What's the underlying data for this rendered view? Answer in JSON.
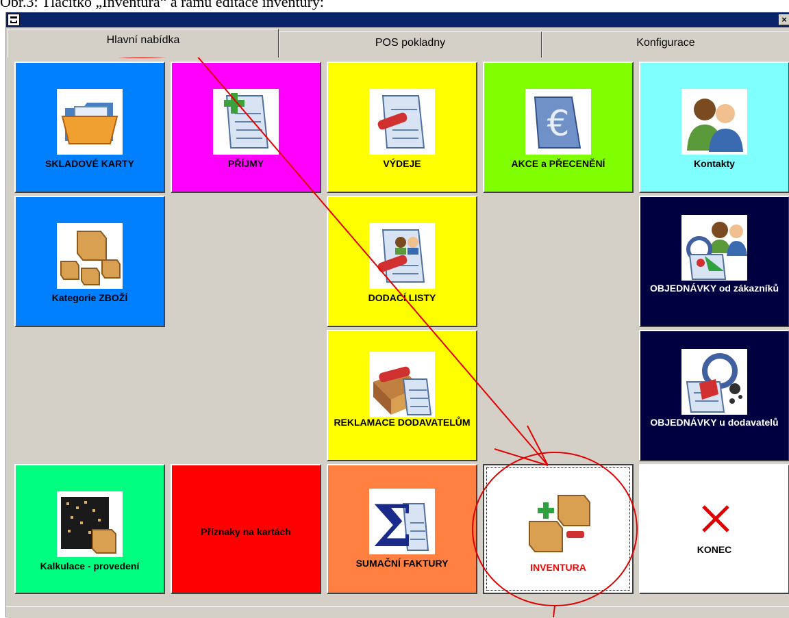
{
  "caption": "Obr.3: Tlačítko „Inventura“ a rámu editace inventury:",
  "window": {
    "close_label": "×"
  },
  "tabs": [
    {
      "label": "Hlavní nabídka",
      "active": true
    },
    {
      "label": "POS pokladny",
      "active": false
    },
    {
      "label": "Konfigurace",
      "active": false
    }
  ],
  "tiles": {
    "skladove_karty": {
      "label": "SKLADOVÉ KARTY",
      "color": "#0080ff",
      "icon": "folder-icon"
    },
    "prijmy": {
      "label": "PŘÍJMY",
      "color": "#ff00ff",
      "icon": "document-add-icon"
    },
    "vydeje": {
      "label": "VÝDEJE",
      "color": "#ffff00",
      "icon": "document-remove-icon"
    },
    "akce": {
      "label": "AKCE a PŘECENĚNÍ",
      "color": "#80ff00",
      "icon": "euro-document-icon"
    },
    "kontakty": {
      "label": "Kontakty",
      "color": "#80ffff",
      "icon": "people-icon"
    },
    "kategorie": {
      "label": "Kategorie ZBOŽÍ",
      "color": "#0080ff",
      "icon": "boxes-icon"
    },
    "dodaci_listy": {
      "label": "DODACÍ LISTY",
      "color": "#ffff00",
      "icon": "delivery-note-icon"
    },
    "obj_zakazniku": {
      "label": "OBJEDNÁVKY od zákazníků",
      "color": "#000040",
      "icon": "customer-order-icon"
    },
    "reklamace": {
      "label": "REKLAMACE DODAVATELŮM",
      "color": "#ffff00",
      "icon": "complaint-icon"
    },
    "obj_dodavatelu": {
      "label": "OBJEDNÁVKY u dodavatelů",
      "color": "#000040",
      "icon": "supplier-order-icon"
    },
    "kalkulace": {
      "label": "Kalkulace - provedení",
      "color": "#00ff80",
      "icon": "calculation-icon"
    },
    "priznaky": {
      "label": "Příznaky na kartách",
      "color": "#ff0000",
      "icon": ""
    },
    "sumacni": {
      "label": "SUMAČNÍ FAKTURY",
      "color": "#ff8040",
      "icon": "sigma-icon"
    },
    "inventura": {
      "label": "INVENTURA",
      "color": "#ffffff",
      "icon": "inventory-boxes-icon",
      "label_color": "#ff0000"
    },
    "konec": {
      "label": "KONEC",
      "color": "#ffffff",
      "icon": "close-icon"
    }
  },
  "annotation_color": "#e00000"
}
